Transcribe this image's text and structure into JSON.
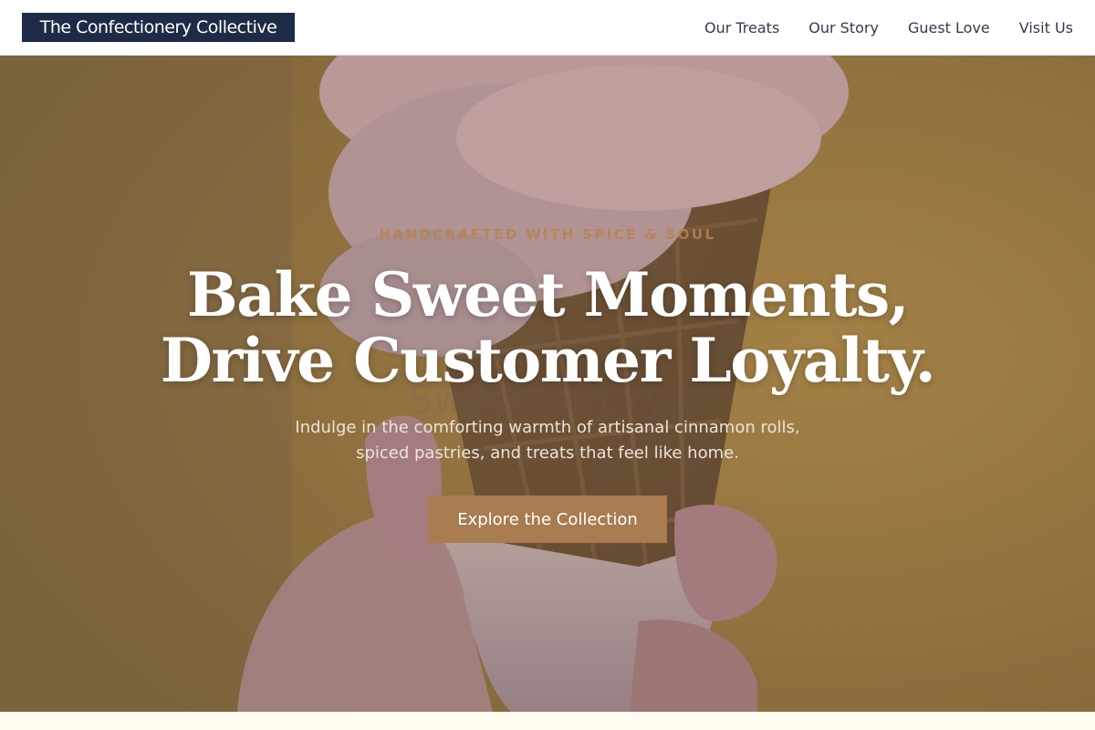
{
  "header": {
    "logo": "The Confectionery Collective",
    "nav": [
      "Our Treats",
      "Our Story",
      "Guest Love",
      "Visit Us"
    ]
  },
  "hero": {
    "eyebrow": "HANDCRAFTED WITH SPICE & SOUL",
    "headline_line1": "Bake Sweet Moments,",
    "headline_line2": "Drive Customer Loyalty.",
    "watermark": "Sweetcom.xyz",
    "subhead_line1": "Indulge in the comforting warmth of artisanal cinnamon rolls,",
    "subhead_line2": "spiced pastries, and treats that feel like home.",
    "cta_label": "Explore the Collection"
  },
  "colors": {
    "logo_bg": "#1d2b47",
    "nav_text": "#333b4a",
    "eyebrow": "#b8834e",
    "cta_bg": "#a87b50",
    "section_bg": "#fffbee"
  }
}
